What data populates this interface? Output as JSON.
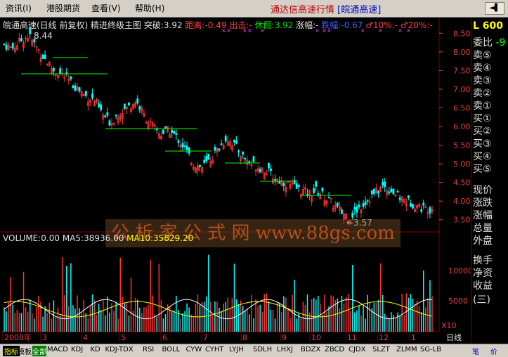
{
  "menu": {
    "items": [
      {
        "label": "资讯(I)"
      },
      {
        "label": "港股期货"
      },
      {
        "label": "查看(V)"
      },
      {
        "label": "帮助(H)"
      }
    ]
  },
  "app_title": "通达信高速行情",
  "app_stock": "[皖通高速]",
  "header": {
    "name": "皖通高速(日线 前复权) 精进终级主图",
    "tupo": "突破:3.92",
    "juli": "距离:-0.49",
    "chuji": "出击:-",
    "xiuxian": "休假:3.92",
    "zhangfu": "涨幅:-",
    "diefu": "跌幅:-0.67",
    "t10": "♂10%:-",
    "t20": "♂20%:-",
    "peak": "8.44",
    "trough": "←3.57"
  },
  "volume": {
    "label": "VOLUME:0.00",
    "ma5": "MA5:38936.00",
    "ma10": "MA10:35829.20"
  },
  "price_axis": [
    "8.50",
    "8.00",
    "7.50",
    "7.00",
    "6.50",
    "6.00",
    "5.50",
    "5.00",
    "4.50",
    "4.00",
    "3.50"
  ],
  "vol_axis": [
    "10000",
    "5000",
    "X10"
  ],
  "months": [
    "2008年",
    "3",
    "4",
    "5",
    "6",
    "7",
    "8",
    "9",
    "10",
    "11",
    "12",
    "1"
  ],
  "right_panel": {
    "code": "600",
    "items": [
      "委比",
      "卖⑤",
      "卖④",
      "卖③",
      "卖②",
      "卖①",
      "买①",
      "买②",
      "买③",
      "买④",
      "买⑤",
      "现价",
      "涨跌",
      "涨幅",
      "总量",
      "外盘",
      "换手",
      "净资",
      "收益(三)"
    ],
    "weibi": "-9"
  },
  "period_label": "日线",
  "tabs": [
    "指标",
    "模板",
    "全部",
    "MACD",
    "KDJ",
    "KD",
    "KDJ-TDX",
    "RSI",
    "BOLL",
    "CYW",
    "CYHT",
    "LYJH",
    "SDLH",
    "LHXJ",
    "BDZX",
    "ZBCD",
    "CJDX",
    "SLZT",
    "ZLMM",
    "SG-LB"
  ],
  "tab_right": [
    "笔",
    "价"
  ],
  "watermark": "公 析 家 公 式 网 www.88gs.com",
  "chart_data": {
    "type": "candlestick",
    "title": "皖通高速(日线 前复权)",
    "ylim": [
      3.4,
      8.6
    ],
    "x_months": [
      "2008年",
      "3",
      "4",
      "5",
      "6",
      "7",
      "8",
      "9",
      "10",
      "11",
      "12",
      "1"
    ],
    "close_path": [
      8.2,
      8.1,
      8.3,
      8.44,
      8.1,
      7.8,
      7.5,
      7.4,
      7.2,
      7.0,
      6.8,
      6.7,
      6.3,
      6.1,
      6.4,
      6.5,
      6.7,
      6.3,
      6.0,
      5.8,
      5.9,
      5.7,
      5.4,
      5.0,
      4.9,
      5.1,
      5.4,
      5.7,
      5.5,
      5.2,
      5.0,
      4.9,
      4.8,
      4.6,
      4.5,
      4.4,
      4.3,
      4.2,
      4.3,
      4.1,
      3.9,
      3.7,
      3.57,
      3.8,
      4.0,
      4.2,
      4.4,
      4.3,
      4.1,
      4.0,
      3.9,
      3.8,
      3.8
    ]
  }
}
